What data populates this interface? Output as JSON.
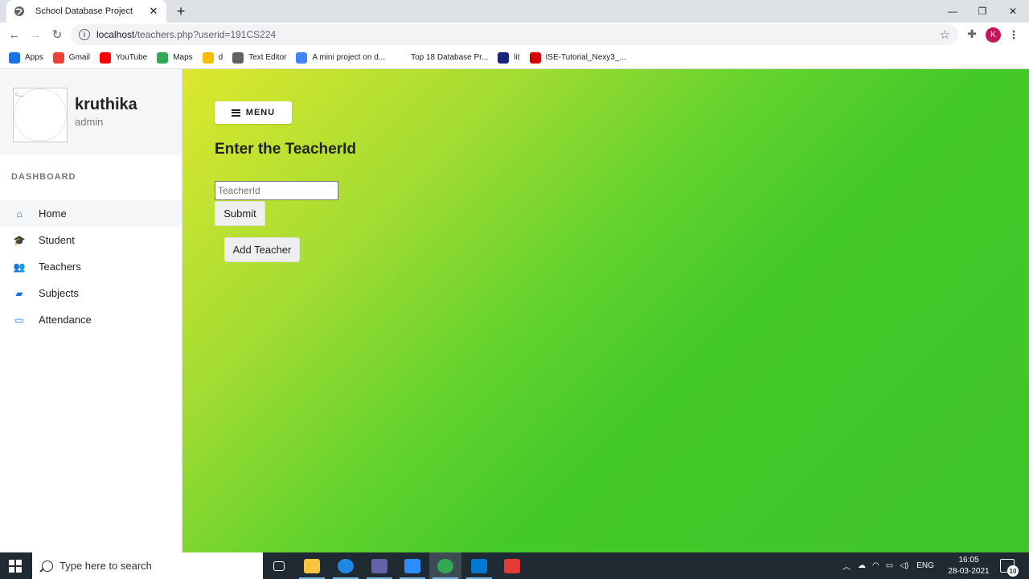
{
  "browser": {
    "tab_title": "School Database Project",
    "url_host": "localhost",
    "url_path": "/teachers.php?userid=191CS224",
    "profile_initial": "K"
  },
  "bookmarks": [
    {
      "label": "Apps",
      "icon": "apps-grid-icon",
      "color": "#1a73e8"
    },
    {
      "label": "Gmail",
      "icon": "gmail-icon",
      "color": "#ea4335"
    },
    {
      "label": "YouTube",
      "icon": "youtube-icon",
      "color": "#ff0000"
    },
    {
      "label": "Maps",
      "icon": "maps-pin-icon",
      "color": "#34a853"
    },
    {
      "label": "d",
      "icon": "windows-tiles-icon",
      "color": "#fbbc04"
    },
    {
      "label": "Text Editor",
      "icon": "globe-icon",
      "color": "#5f6368"
    },
    {
      "label": "A mini project on d...",
      "icon": "doc-icon",
      "color": "#4285f4"
    },
    {
      "label": "Top 18 Database Pr...",
      "icon": "blank-icon",
      "color": "#ffffff"
    },
    {
      "label": "lit",
      "icon": "lit-icon",
      "color": "#1a237e"
    },
    {
      "label": "ISE-Tutorial_Nexy3_...",
      "icon": "u-shield-icon",
      "color": "#d50000"
    }
  ],
  "sidebar": {
    "avatar_alt": "...",
    "user_name": "kruthika",
    "user_role": "admin",
    "section_label": "DASHBOARD",
    "items": [
      {
        "label": "Home",
        "icon": "home-icon",
        "glyph": "⌂"
      },
      {
        "label": "Student",
        "icon": "graduation-cap-icon",
        "glyph": "🎓"
      },
      {
        "label": "Teachers",
        "icon": "users-icon",
        "glyph": "👥"
      },
      {
        "label": "Subjects",
        "icon": "book-icon",
        "glyph": "▰"
      },
      {
        "label": "Attendance",
        "icon": "calendar-icon",
        "glyph": "▭"
      }
    ]
  },
  "main": {
    "menu_label": "MENU",
    "heading": "Enter the TeacherId",
    "input_placeholder": "TeacherId",
    "input_value": "",
    "submit_label": "Submit",
    "add_label": "Add Teacher"
  },
  "taskbar": {
    "search_placeholder": "Type here to search",
    "apps": [
      {
        "name": "task-view-icon",
        "color": "#ffffff"
      },
      {
        "name": "file-explorer-icon",
        "color": "#f8c43c"
      },
      {
        "name": "edge-icon",
        "color": "#1e88e5"
      },
      {
        "name": "teams-icon",
        "color": "#6264a7"
      },
      {
        "name": "zoom-icon",
        "color": "#2d8cff"
      },
      {
        "name": "chrome-icon",
        "color": "#34a853"
      },
      {
        "name": "vscode-icon",
        "color": "#0078d4"
      },
      {
        "name": "app-tiles-icon",
        "color": "#e53935"
      }
    ],
    "lang": "ENG",
    "time": "16:05",
    "date": "28-03-2021",
    "notification_count": "10"
  }
}
